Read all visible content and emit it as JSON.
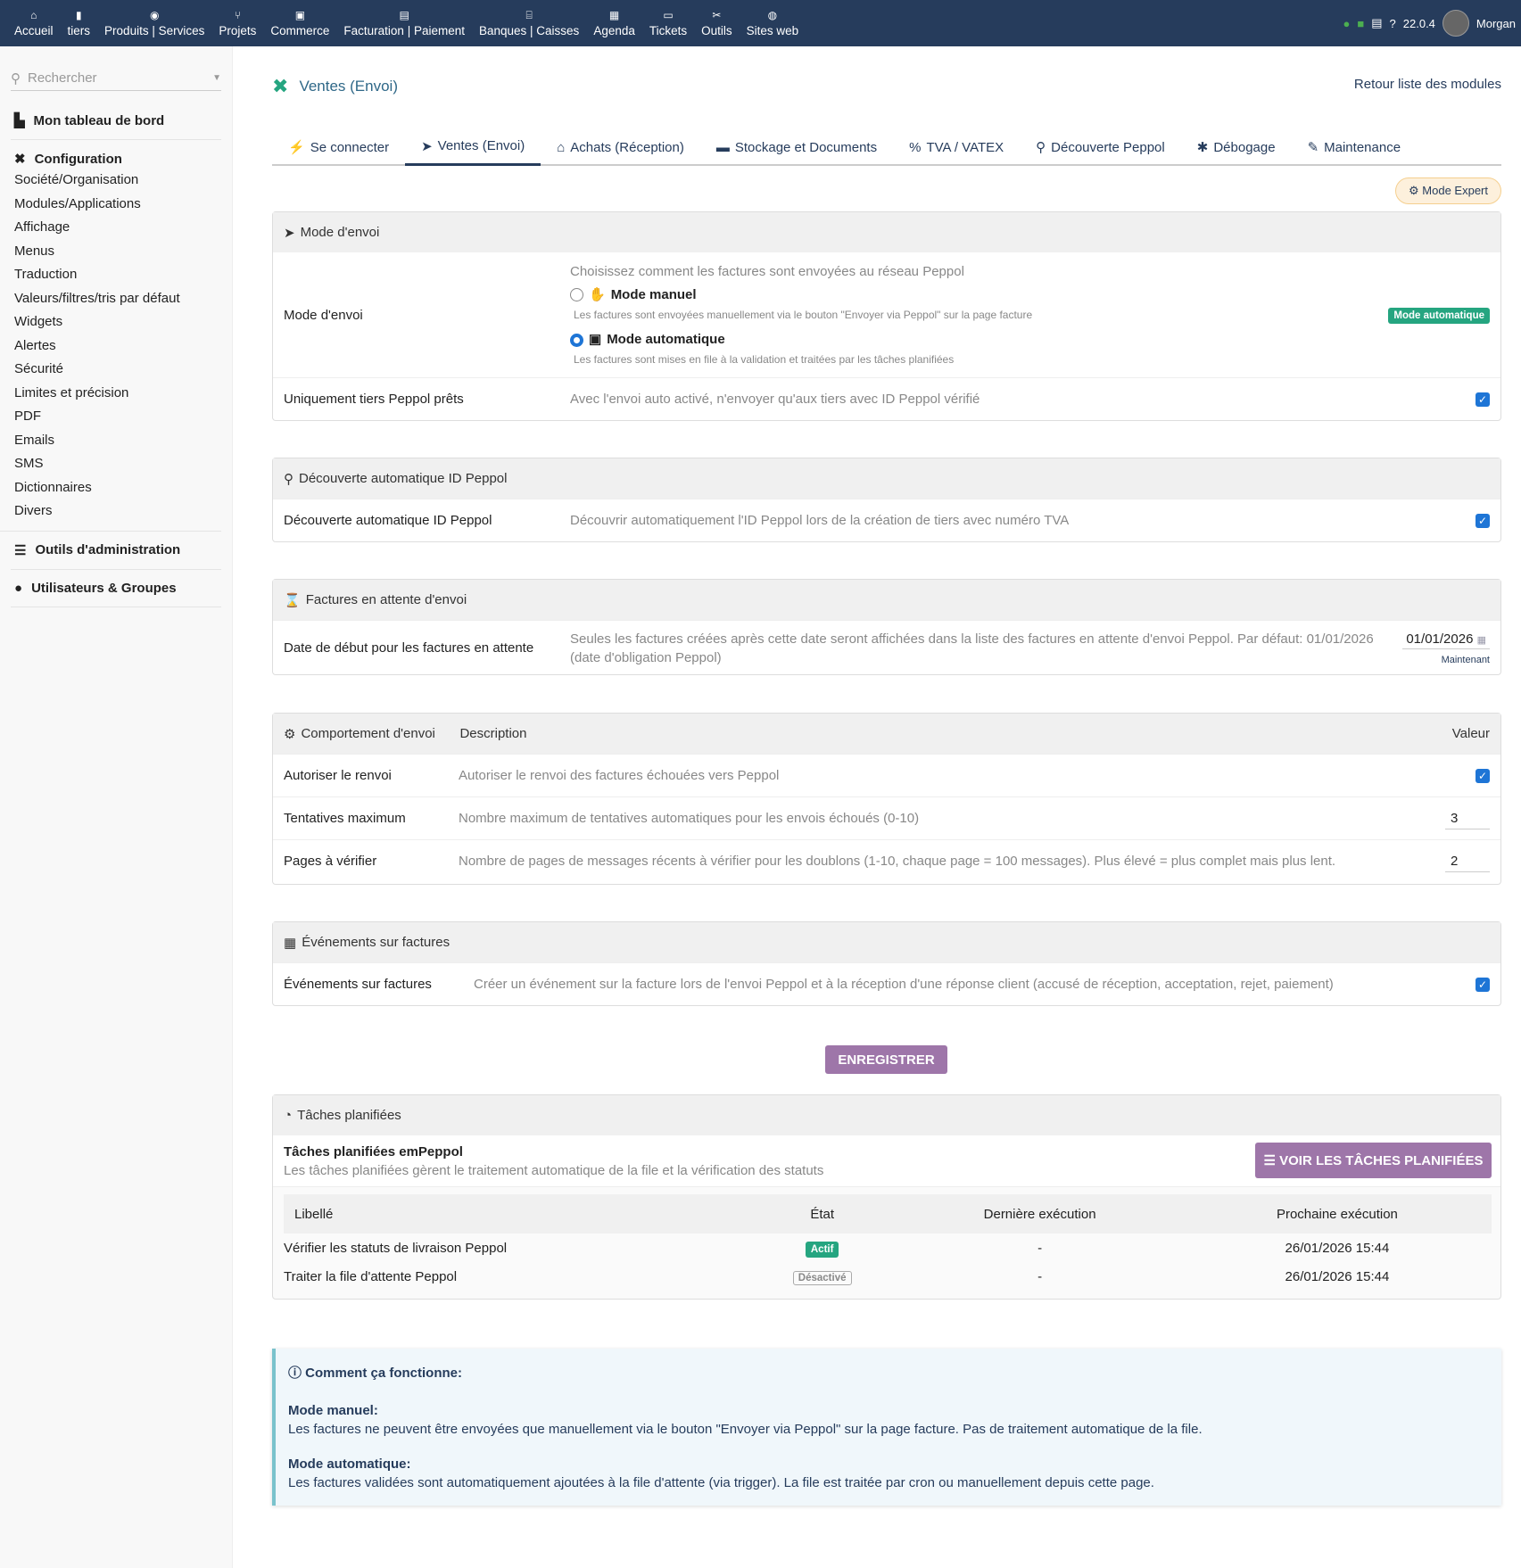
{
  "topnav": {
    "items": [
      {
        "label": "Accueil",
        "icon": "⌂"
      },
      {
        "label": "tiers",
        "icon": "▮"
      },
      {
        "label": "Produits | Services",
        "icon": "◉"
      },
      {
        "label": "Projets",
        "icon": "⑂"
      },
      {
        "label": "Commerce",
        "icon": "▣"
      },
      {
        "label": "Facturation | Paiement",
        "icon": "▤"
      },
      {
        "label": "Banques | Caisses",
        "icon": "⌸"
      },
      {
        "label": "Agenda",
        "icon": "▦"
      },
      {
        "label": "Tickets",
        "icon": "▭"
      },
      {
        "label": "Outils",
        "icon": "✂"
      },
      {
        "label": "Sites web",
        "icon": "◍"
      }
    ],
    "version": "22.0.4",
    "user": "Morgan"
  },
  "sidebar": {
    "search_placeholder": "Rechercher",
    "dashboard": "Mon tableau de bord",
    "config": "Configuration",
    "links": [
      "Société/Organisation",
      "Modules/Applications",
      "Affichage",
      "Menus",
      "Traduction",
      "Valeurs/filtres/tris par défaut",
      "Widgets",
      "Alertes",
      "Sécurité",
      "Limites et précision",
      "PDF",
      "Emails",
      "SMS",
      "Dictionnaires",
      "Divers"
    ],
    "admin": "Outils d'administration",
    "users": "Utilisateurs & Groupes"
  },
  "page": {
    "title": "Ventes (Envoi)",
    "back": "Retour liste des modules",
    "expert": "Mode Expert",
    "tabs": [
      "Se connecter",
      "Ventes (Envoi)",
      "Achats (Réception)",
      "Stockage et Documents",
      "TVA / VATEX",
      "Découverte Peppol",
      "Débogage",
      "Maintenance"
    ]
  },
  "s1": {
    "head": "Mode d'envoi",
    "label": "Mode d'envoi",
    "intro": "Choisissez comment les factures sont envoyées au réseau Peppol",
    "manual": "Mode manuel",
    "manual_desc": "Les factures sont envoyées manuellement via le bouton \"Envoyer via Peppol\" sur la page facture",
    "auto": "Mode automatique",
    "auto_desc": "Les factures sont mises en file à la validation et traitées par les tâches planifiées",
    "badge": "Mode automatique",
    "r2_label": "Uniquement tiers Peppol prêts",
    "r2_desc": "Avec l'envoi auto activé, n'envoyer qu'aux tiers avec ID Peppol vérifié"
  },
  "s2": {
    "head": "Découverte automatique ID Peppol",
    "label": "Découverte automatique ID Peppol",
    "desc": "Découvrir automatiquement l'ID Peppol lors de la création de tiers avec numéro TVA"
  },
  "s3": {
    "head": "Factures en attente d'envoi",
    "label": "Date de début pour les factures en attente",
    "desc": "Seules les factures créées après cette date seront affichées dans la liste des factures en attente d'envoi Peppol. Par défaut: 01/01/2026 (date d'obligation Peppol)",
    "date": "01/01/2026",
    "now": "Maintenant"
  },
  "s4": {
    "head": "Comportement d'envoi",
    "col_desc": "Description",
    "col_val": "Valeur",
    "rows": [
      {
        "label": "Autoriser le renvoi",
        "desc": "Autoriser le renvoi des factures échouées vers Peppol"
      },
      {
        "label": "Tentatives maximum",
        "desc": "Nombre maximum de tentatives automatiques pour les envois échoués (0-10)",
        "value": "3"
      },
      {
        "label": "Pages à vérifier",
        "desc": "Nombre de pages de messages récents à vérifier pour les doublons (1-10, chaque page = 100 messages). Plus élevé = plus complet mais plus lent.",
        "value": "2"
      }
    ]
  },
  "s5": {
    "head": "Événements sur factures",
    "label": "Événements sur factures",
    "desc": "Créer un événement sur la facture lors de l'envoi Peppol et à la réception d'une réponse client (accusé de réception, acceptation, rejet, paiement)"
  },
  "save": "ENREGISTRER",
  "s6": {
    "head": "Tâches planifiées",
    "title": "Tâches planifiées emPeppol",
    "sub": "Les tâches planifiées gèrent le traitement automatique de la file et la vérification des statuts",
    "button": "VOIR LES TÂCHES PLANIFIÉES",
    "cols": [
      "Libellé",
      "État",
      "Dernière exécution",
      "Prochaine exécution"
    ],
    "rows": [
      {
        "label": "Vérifier les statuts de livraison Peppol",
        "state": "Actif",
        "last": "-",
        "next": "26/01/2026 15:44"
      },
      {
        "label": "Traiter la file d'attente Peppol",
        "state": "Désactivé",
        "last": "-",
        "next": "26/01/2026 15:44"
      }
    ]
  },
  "info": {
    "title": "Comment ça fonctionne:",
    "m1": "Mode manuel:",
    "m1d": "Les factures ne peuvent être envoyées que manuellement via le bouton \"Envoyer via Peppol\" sur la page facture. Pas de traitement automatique de la file.",
    "m2": "Mode automatique:",
    "m2d": "Les factures validées sont automatiquement ajoutées à la file d'attente (via trigger). La file est traitée par cron ou manuellement depuis cette page."
  }
}
